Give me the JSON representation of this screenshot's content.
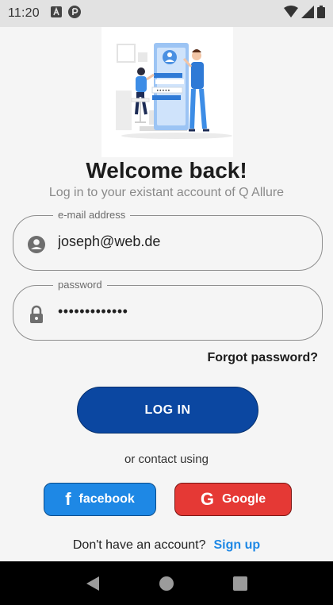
{
  "status_bar": {
    "time": "11:20",
    "icons": [
      "a-badge-icon",
      "app-status-icon",
      "wifi-icon",
      "signal-icon",
      "battery-icon"
    ]
  },
  "welcome": {
    "title": "Welcome back!",
    "subtitle": "Log in to your existant account of Q Allure"
  },
  "email": {
    "label": "e-mail address",
    "value": "joseph@web.de",
    "icon": "account-circle-icon"
  },
  "password": {
    "label": "password",
    "value": "•••••••••••••",
    "icon": "lock-icon"
  },
  "forgot_password": "Forgot password?",
  "login_button": "LOG IN",
  "contact_text": "or contact using",
  "social": {
    "facebook": {
      "label": "facebook",
      "icon_glyph": "f",
      "color": "#1e88e5"
    },
    "google": {
      "label": "Google",
      "icon_glyph": "G",
      "color": "#e53935"
    }
  },
  "signup": {
    "question": "Don't have an account?",
    "link": "Sign up"
  },
  "colors": {
    "primary": "#0b47a1",
    "link": "#1e88e5"
  },
  "nav": [
    "back-icon",
    "home-icon",
    "recents-icon"
  ]
}
